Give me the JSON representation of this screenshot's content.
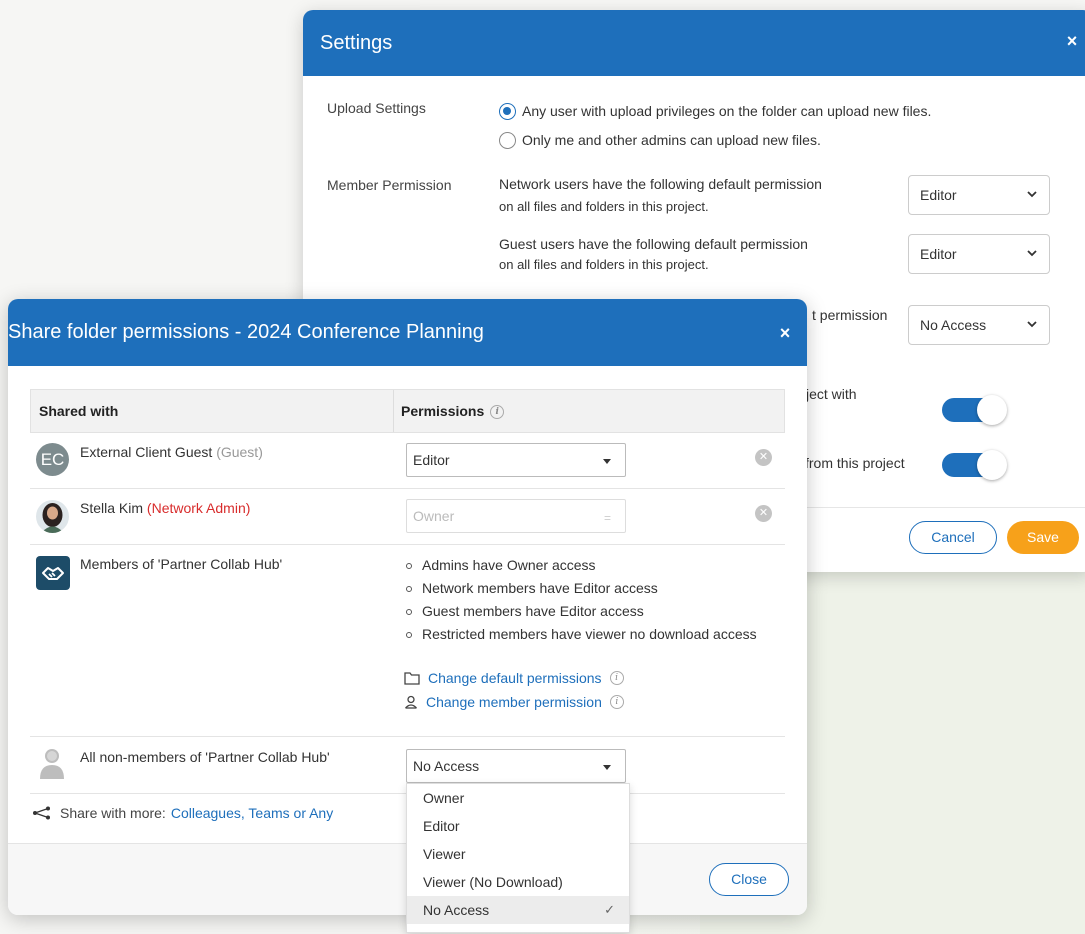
{
  "settings": {
    "title": "Settings",
    "close_glyph": "×",
    "upload_label": "Upload Settings",
    "upload_options": [
      {
        "text": "Any user with upload privileges on the folder can upload new files.",
        "checked": true
      },
      {
        "text": "Only me and other admins can upload new files.",
        "checked": false
      }
    ],
    "member_label": "Member Permission",
    "network_text_1": "Network users have the following default permission",
    "network_text_2": "on all files and folders in this project.",
    "network_value": "Editor",
    "guest_text_1": "Guest users have the following default permission",
    "guest_text_2": "on all files and folders in this project.",
    "third_text": "t permission",
    "third_value": "No Access",
    "toggle1_text": "ject with",
    "toggle2_text": "from this project",
    "cancel": "Cancel",
    "save": "Save",
    "accent": "#1e6fbb",
    "save_color": "#f7a11a"
  },
  "share": {
    "title": "Share folder permissions -  2024 Conference Planning",
    "close_glyph": "×",
    "col_shared": "Shared with",
    "col_permissions": "Permissions",
    "info_glyph": "i",
    "rows": [
      {
        "avatar": "EC",
        "name": "External Client Guest",
        "role": "(Guest)",
        "permission": "Editor"
      },
      {
        "name": "Stella Kim",
        "role": "(Network Admin)",
        "permission": "Owner"
      },
      {
        "name": "Members of 'Partner Collab Hub'"
      },
      {
        "name": "All non-members of 'Partner Collab Hub'",
        "permission": "No Access"
      }
    ],
    "bullets": [
      "Admins have Owner access",
      "Network members have Editor access",
      "Guest members have Editor access",
      "Restricted members have viewer no download access"
    ],
    "link_default": "Change default permissions",
    "link_member": "Change member permission",
    "share_more_label": "Share with more:",
    "share_more_link": "Colleagues, Teams or Any",
    "close_button": "Close",
    "menu_options": [
      "Owner",
      "Editor",
      "Viewer",
      "Viewer (No Download)",
      "No Access"
    ],
    "menu_selected": "No Access",
    "check_glyph": "✓"
  }
}
